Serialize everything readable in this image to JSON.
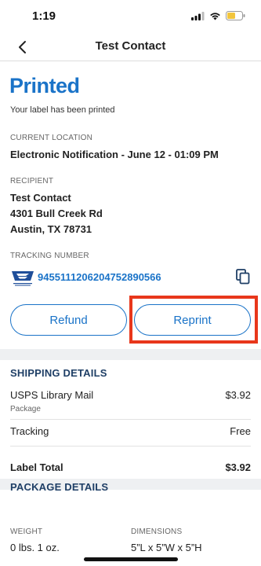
{
  "status_bar": {
    "time": "1:19"
  },
  "nav": {
    "title": "Test Contact"
  },
  "status": {
    "title": "Printed",
    "subtitle": "Your label has been printed",
    "accent_color": "#1a73c8"
  },
  "current_location": {
    "label": "CURRENT LOCATION",
    "value": "Electronic Notification - June 12 - 01:09 PM"
  },
  "recipient": {
    "label": "RECIPIENT",
    "name": "Test Contact",
    "address_line1": "4301 Bull Creek Rd",
    "address_line2": "Austin, TX 78731"
  },
  "tracking": {
    "label": "TRACKING NUMBER",
    "number": "9455111206204752890566",
    "carrier_icon": "usps-eagle-logo",
    "copy_icon": "copy-icon"
  },
  "actions": {
    "refund_label": "Refund",
    "reprint_label": "Reprint",
    "highlight_color": "#e8371b"
  },
  "shipping_details": {
    "title": "SHIPPING DETAILS",
    "service_name": "USPS Library Mail",
    "service_sub": "Package",
    "service_price": "$3.92",
    "tracking_label": "Tracking",
    "tracking_price": "Free",
    "total_label": "Label Total",
    "total_price": "$3.92"
  },
  "package_details": {
    "title": "PACKAGE DETAILS",
    "weight_label": "WEIGHT",
    "weight_value": "0 lbs. 1 oz.",
    "dimensions_label": "DIMENSIONS",
    "dimensions_value": "5”L x 5”W x 5”H"
  }
}
